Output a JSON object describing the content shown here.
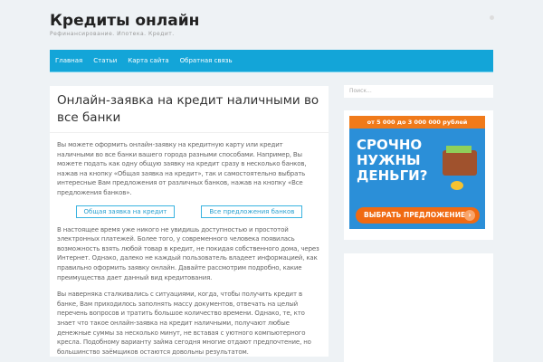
{
  "header": {
    "title": "Кредиты онлайн",
    "tagline": "Рефинансирование. Ипотека. Кредит."
  },
  "nav": [
    "Главная",
    "Статьи",
    "Карта сайта",
    "Обратная связь"
  ],
  "article": {
    "title": "Онлайн-заявка на кредит наличными во все банки",
    "p1": "Вы можете оформить онлайн-заявку на кредитную карту или кредит наличными во все банки вашего города разными способами. Например, Вы можете подать как одну общую заявку на кредит сразу в несколько банков, нажав на кнопку «Общая заявка на кредит», так и самостоятельно выбрать интересные Вам предложения от различных банков, нажав на кнопку «Все предложения банков».",
    "btn1": "Общая заявка на кредит",
    "btn2": "Все предложения банков",
    "p2": "В настоящее время уже никого не увидишь доступностью и простотой электронных платежей. Более того, у современного человека появилась возможность взять любой товар в кредит, не покидая собственного дома, через Интернет. Однако, далеко не каждый пользователь владеет информацией, как правильно оформить заявку онлайн. Давайте рассмотрим подробно, какие преимущества дает данный вид кредитования.",
    "p3": "Вы наверняка сталкивались с ситуациями, когда, чтобы получить кредит в банке, Вам приходилось заполнять массу документов, отвечать на целый перечень вопросов и тратить большое количество времени. Однако, те, кто знает что такое онлайн-заявка на кредит наличными, получают любые денежные суммы за несколько минут, не вставая с уютного компьютерного кресла. Подобному варианту займа сегодня многие отдают предпочтение, но большинство заёмщиков остаются довольны результатом."
  },
  "sidebar": {
    "search_placeholder": "Поиск...",
    "ad": {
      "top": "от 5 000 до 3 000 000 рублей",
      "headline": "СРОЧНО НУЖНЫ ДЕНЬГИ?",
      "cta": "ВЫБРАТЬ ПРЕДЛОЖЕНИЕ",
      "chev": "›"
    }
  }
}
